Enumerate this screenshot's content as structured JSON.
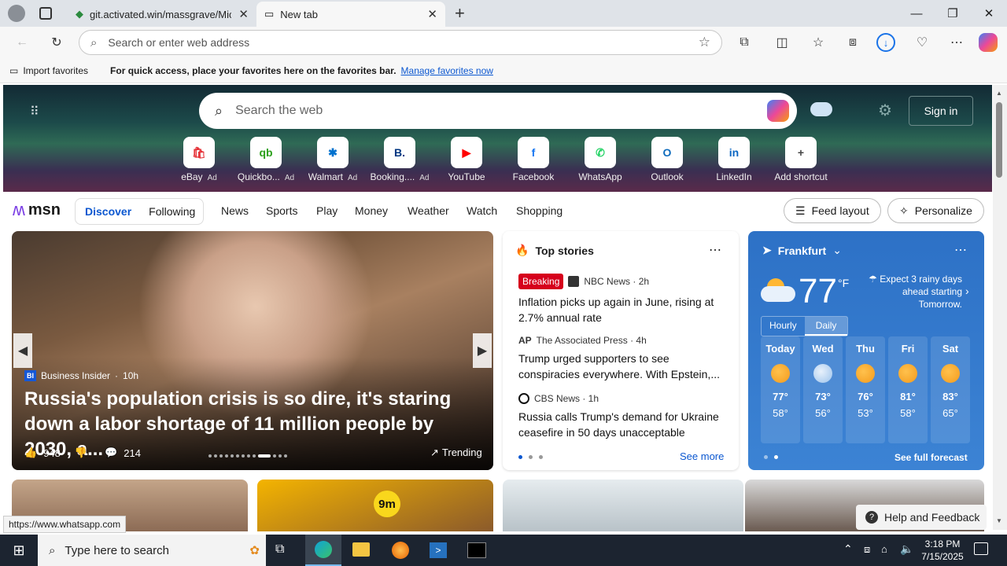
{
  "tabs": [
    {
      "label": "git.activated.win/massgrave/Micr"
    },
    {
      "label": "New tab"
    }
  ],
  "address": {
    "placeholder": "Search or enter web address"
  },
  "favbar": {
    "import_label": "Import favorites",
    "message": "For quick access, place your favorites here on the favorites bar.",
    "manage_link": "Manage favorites now"
  },
  "hero": {
    "search_placeholder": "Search the web",
    "sign_in": "Sign in",
    "shortcuts": [
      {
        "label": "eBay",
        "ad": "Ad",
        "letter": "🛍",
        "color": "#e53238"
      },
      {
        "label": "Quickbo...",
        "ad": "Ad",
        "letter": "qb",
        "color": "#2ca01c"
      },
      {
        "label": "Walmart",
        "ad": "Ad",
        "letter": "✱",
        "color": "#0071ce"
      },
      {
        "label": "Booking....",
        "ad": "Ad",
        "letter": "B.",
        "color": "#003580"
      },
      {
        "label": "YouTube",
        "ad": "",
        "letter": "▶",
        "color": "#ff0000"
      },
      {
        "label": "Facebook",
        "ad": "",
        "letter": "f",
        "color": "#1877f2"
      },
      {
        "label": "WhatsApp",
        "ad": "",
        "letter": "✆",
        "color": "#25d366"
      },
      {
        "label": "Outlook",
        "ad": "",
        "letter": "O",
        "color": "#0f6cbd"
      },
      {
        "label": "LinkedIn",
        "ad": "",
        "letter": "in",
        "color": "#0a66c2"
      },
      {
        "label": "Add shortcut",
        "ad": "",
        "letter": "+",
        "color": "#444"
      }
    ]
  },
  "msn": {
    "logo": "msn",
    "tabs": [
      "Discover",
      "Following"
    ],
    "nav": [
      "News",
      "Sports",
      "Play",
      "Money",
      "Weather",
      "Watch",
      "Shopping"
    ],
    "feed_layout": "Feed layout",
    "personalize": "Personalize"
  },
  "hero_card": {
    "source": "Business Insider",
    "time": "10h",
    "source_badge": "BI",
    "headline": "Russia's population crisis is so dire, it's staring down a labor shortage of 11 million people by 2030, a...",
    "likes": "948",
    "comments": "214",
    "trending": "Trending"
  },
  "top_stories": {
    "title": "Top stories",
    "items": [
      {
        "badge": "Breaking",
        "source": "NBC News · 2h",
        "headline": "Inflation picks up again in June, rising at 2.7% annual rate"
      },
      {
        "badge": "",
        "source": "The Associated Press · 4h",
        "headline": "Trump urged supporters to see conspiracies everywhere. With Epstein,..."
      },
      {
        "badge": "",
        "source": "CBS News · 1h",
        "headline": "Russia calls Trump's demand for Ukraine ceasefire in 50 days unacceptable"
      }
    ],
    "see_more": "See more"
  },
  "weather": {
    "location": "Frankfurt",
    "temp": "77",
    "unit": "°F",
    "alert": "Expect 3 rainy days ahead starting Tomorrow.",
    "toggle": [
      "Hourly",
      "Daily"
    ],
    "days": [
      {
        "name": "Today",
        "hi": "77°",
        "lo": "58°"
      },
      {
        "name": "Wed",
        "hi": "73°",
        "lo": "56°"
      },
      {
        "name": "Thu",
        "hi": "76°",
        "lo": "53°"
      },
      {
        "name": "Fri",
        "hi": "81°",
        "lo": "58°"
      },
      {
        "name": "Sat",
        "hi": "83°",
        "lo": "65°"
      }
    ],
    "see_full": "See full forecast"
  },
  "bottom": {
    "badge": "9m",
    "status_url": "https://www.whatsapp.com",
    "help": "Help and Feedback"
  },
  "taskbar": {
    "search": "Type here to search",
    "time": "3:18 PM",
    "date": "7/15/2025"
  }
}
